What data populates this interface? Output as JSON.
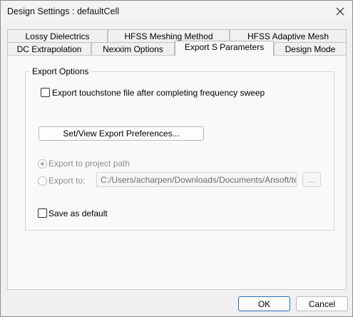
{
  "window": {
    "title": "Design Settings : defaultCell"
  },
  "tabs_row1": [
    {
      "label": "Lossy Dielectrics"
    },
    {
      "label": "HFSS Meshing Method"
    },
    {
      "label": "HFSS Adaptive Mesh"
    }
  ],
  "tabs_row2": [
    {
      "label": "DC Extrapolation"
    },
    {
      "label": "Nexxim Options"
    },
    {
      "label": "Export S Parameters"
    },
    {
      "label": "Design Mode"
    }
  ],
  "active_tab": "Export S Parameters",
  "export_options": {
    "legend": "Export Options",
    "touchstone_checkbox": {
      "label": "Export touchstone file after completing frequency sweep",
      "checked": false
    },
    "preferences_button": "Set/View Export Preferences...",
    "radio_project_path": {
      "label": "Export to project path",
      "selected": true
    },
    "radio_export_to": {
      "label": "Export to:",
      "selected": false
    },
    "export_path": {
      "value": "C:/Users/acharpen/Downloads/Documents/Ansoft/temp/"
    },
    "browse_button": "...",
    "save_default_checkbox": {
      "label": "Save as default",
      "checked": false
    }
  },
  "footer": {
    "ok_label": "OK",
    "cancel_label": "Cancel"
  }
}
